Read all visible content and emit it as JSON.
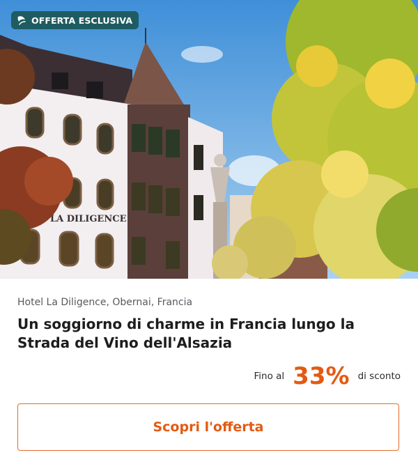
{
  "badge": {
    "icon": "leaf-logo-icon",
    "label": "OFFERTA ESCLUSIVA",
    "color": "#1f5c62"
  },
  "hero": {
    "sign_text": "LA DILIGENCE"
  },
  "offer": {
    "location": "Hotel La Diligence, Obernai, Francia",
    "title": "Un soggiorno di charme in Francia lungo la Strada del Vino dell'Alsazia",
    "discount_prefix": "Fino al",
    "discount_value": "33%",
    "discount_suffix": "di sconto",
    "accent_color": "#e35a12"
  },
  "cta": {
    "label": "Scopri l'offerta"
  }
}
